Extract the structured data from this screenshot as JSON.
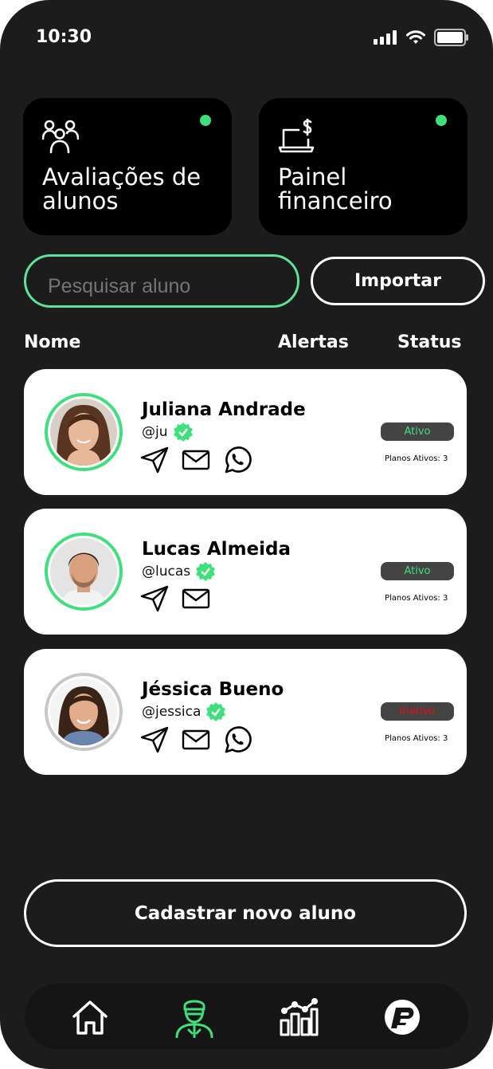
{
  "status_bar": {
    "time": "10:30"
  },
  "shortcuts": [
    {
      "title": "Avaliações de alunos",
      "icon": "users-icon"
    },
    {
      "title": "Painel financeiro",
      "icon": "laptop-dollar-icon"
    }
  ],
  "search": {
    "placeholder": "Pesquisar aluno"
  },
  "import_label": "Importar",
  "columns": {
    "name": "Nome",
    "alerts": "Alertas",
    "status": "Status"
  },
  "students": [
    {
      "name": "Juliana Andrade",
      "handle": "@ju",
      "status": "Ativo",
      "status_color": "#3ee07c",
      "plans": "Planos Ativos: 3",
      "has_whatsapp": true
    },
    {
      "name": "Lucas Almeida",
      "handle": "@lucas",
      "status": "Ativo",
      "status_color": "#3ee07c",
      "plans": "Planos Ativos: 3",
      "has_whatsapp": false
    },
    {
      "name": "Jéssica Bueno",
      "handle": "@jessica",
      "status": "Inativo",
      "status_color": "#e01010",
      "plans": "Planos Ativos: 3",
      "has_whatsapp": true
    }
  ],
  "cta_label": "Cadastrar novo aluno",
  "nav": [
    "home-icon",
    "trainer-icon",
    "chart-icon",
    "logo-icon"
  ],
  "colors": {
    "accent": "#3ee07c",
    "background": "#1c1c1c",
    "card": "#000000"
  }
}
